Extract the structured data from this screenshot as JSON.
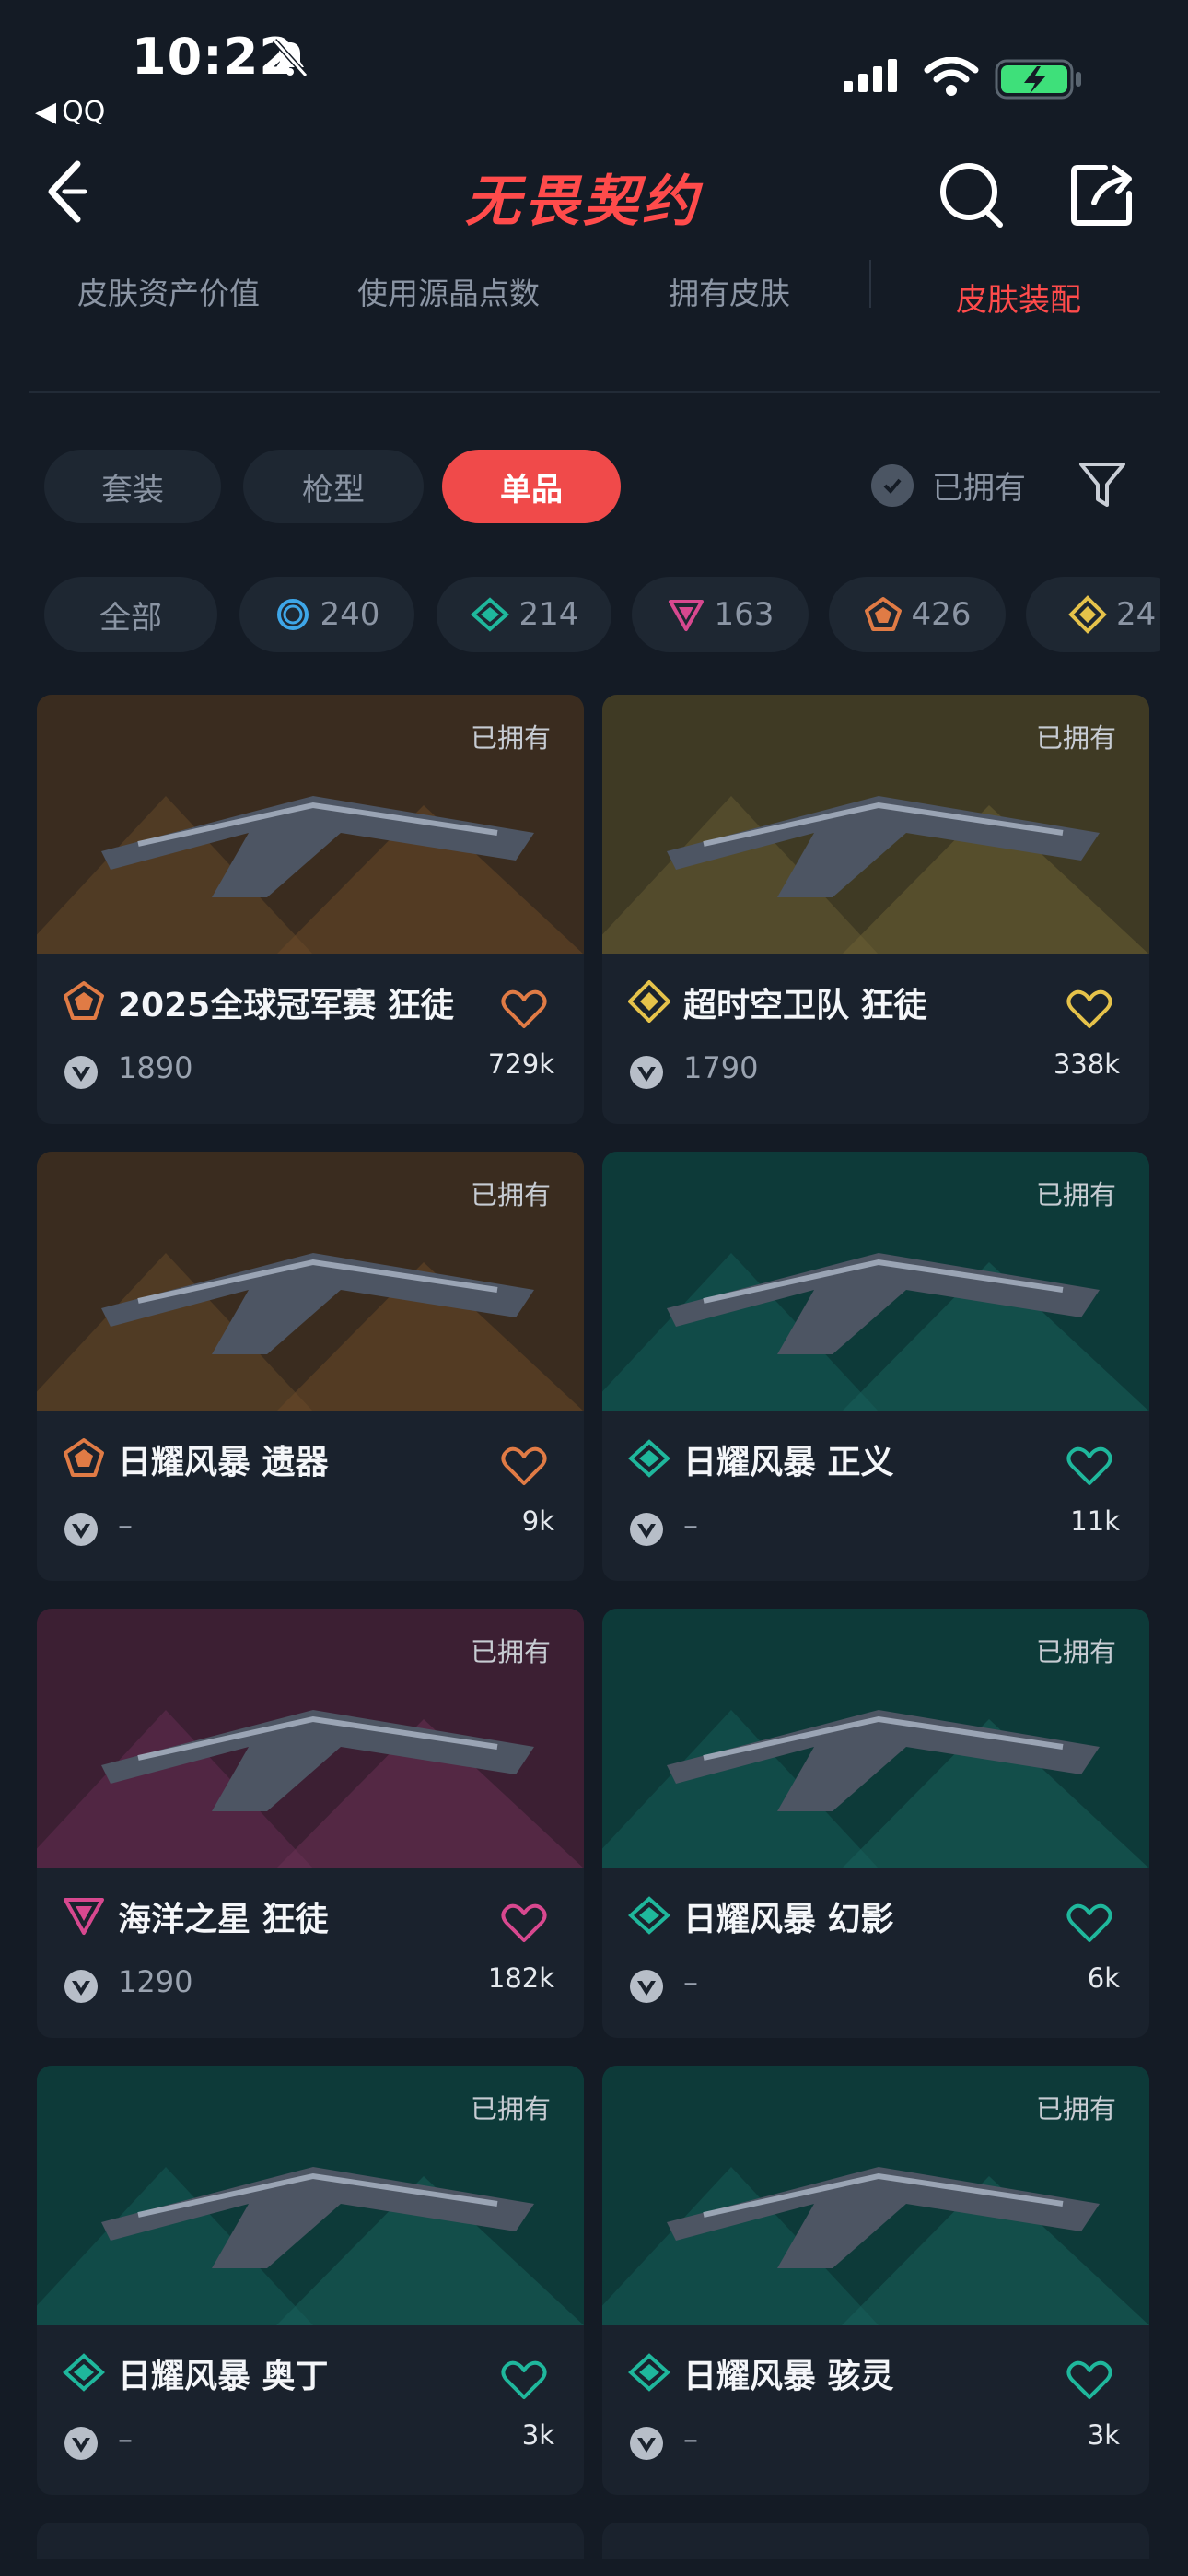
{
  "status_bar": {
    "time": "10:22",
    "back_app": "QQ"
  },
  "nav": {
    "title": "无畏契约"
  },
  "tabs": [
    "皮肤资产价值",
    "使用源晶点数",
    "拥有皮肤",
    "皮肤装配"
  ],
  "active_tab": "皮肤装配",
  "segments": [
    "套装",
    "枪型",
    "单品"
  ],
  "active_segment": "单品",
  "owned_filter_label": "已拥有",
  "chips": [
    {
      "label": "全部",
      "rarity": "all"
    },
    {
      "label": "240",
      "rarity": "select",
      "color": "#3ea6e8"
    },
    {
      "label": "214",
      "rarity": "deluxe",
      "color": "#1fb79c"
    },
    {
      "label": "163",
      "rarity": "premium",
      "color": "#d8488f"
    },
    {
      "label": "426",
      "rarity": "exclusive",
      "color": "#e07b45"
    },
    {
      "label": "24",
      "rarity": "ultra",
      "color": "#e5c24a"
    }
  ],
  "cards": [
    {
      "name": "2025全球冠军赛 狂徒",
      "price": "1890",
      "likes": "729k",
      "owned": "已拥有",
      "rarity_color": "#e07b45",
      "theme": "orange",
      "icon": "exclusive-rarity-icon"
    },
    {
      "name": "超时空卫队 狂徒",
      "price": "1790",
      "likes": "338k",
      "owned": "已拥有",
      "rarity_color": "#e5c24a",
      "theme": "yellow",
      "icon": "ultra-rarity-icon"
    },
    {
      "name": "日耀风暴 遗器",
      "price": "–",
      "likes": "9k",
      "owned": "已拥有",
      "rarity_color": "#e07b45",
      "theme": "orange",
      "icon": "exclusive-rarity-icon"
    },
    {
      "name": "日耀风暴 正义",
      "price": "–",
      "likes": "11k",
      "owned": "已拥有",
      "rarity_color": "#1fb79c",
      "theme": "teal",
      "icon": "deluxe-rarity-icon"
    },
    {
      "name": "海洋之星 狂徒",
      "price": "1290",
      "likes": "182k",
      "owned": "已拥有",
      "rarity_color": "#d8488f",
      "theme": "pink",
      "icon": "premium-rarity-icon"
    },
    {
      "name": "日耀风暴 幻影",
      "price": "–",
      "likes": "6k",
      "owned": "已拥有",
      "rarity_color": "#1fb79c",
      "theme": "teal",
      "icon": "deluxe-rarity-icon"
    },
    {
      "name": "日耀风暴 奥丁",
      "price": "–",
      "likes": "3k",
      "owned": "已拥有",
      "rarity_color": "#1fb79c",
      "theme": "teal",
      "icon": "deluxe-rarity-icon"
    },
    {
      "name": "日耀风暴 骇灵",
      "price": "–",
      "likes": "3k",
      "owned": "已拥有",
      "rarity_color": "#1fb79c",
      "theme": "teal",
      "icon": "deluxe-rarity-icon"
    }
  ]
}
